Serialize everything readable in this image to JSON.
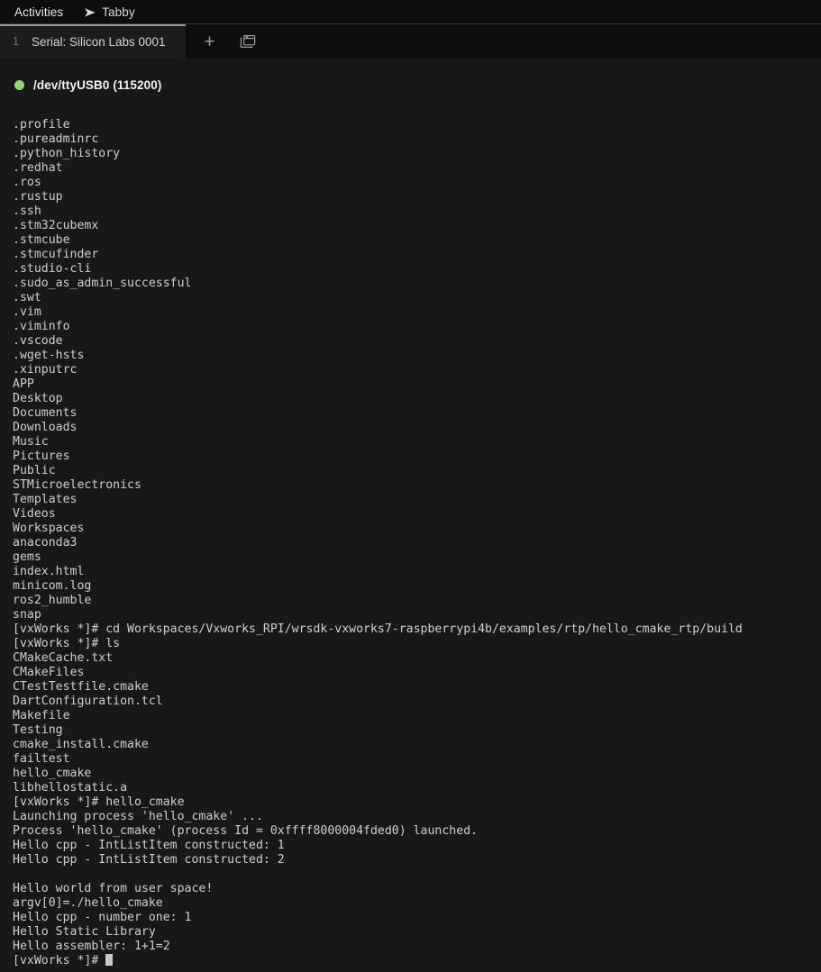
{
  "colors": {
    "topbar_bg": "#0d0d0d",
    "tabbar_bg": "#0e0e0e",
    "active_tab_bg": "#1c1c1c",
    "terminal_bg": "#181818",
    "terminal_fg": "#cfcfcf",
    "status_green": "#8fd96a",
    "cursor": "#c8c8c8",
    "app_title": "#cfd9e6"
  },
  "topbar": {
    "activities_label": "Activities",
    "app_glyph": "➤",
    "app_title": "Tabby"
  },
  "tabbar": {
    "tabs": [
      {
        "index": "1",
        "label": "Serial: Silicon Labs 0001",
        "active": true
      }
    ],
    "new_tab_label": "+",
    "new_tab_icon": "plus-icon",
    "profiles_icon": "stacked-windows-icon"
  },
  "terminal": {
    "connection": {
      "status_icon": "green-dot-icon",
      "label": "/dev/ttyUSB0 (115200)"
    },
    "cursor": "█",
    "lines": [
      ".profile",
      ".pureadminrc",
      ".python_history",
      ".redhat",
      ".ros",
      ".rustup",
      ".ssh",
      ".stm32cubemx",
      ".stmcube",
      ".stmcufinder",
      ".studio-cli",
      ".sudo_as_admin_successful",
      ".swt",
      ".vim",
      ".viminfo",
      ".vscode",
      ".wget-hsts",
      ".xinputrc",
      "APP",
      "Desktop",
      "Documents",
      "Downloads",
      "Music",
      "Pictures",
      "Public",
      "STMicroelectronics",
      "Templates",
      "Videos",
      "Workspaces",
      "anaconda3",
      "gems",
      "index.html",
      "minicom.log",
      "ros2_humble",
      "snap",
      "[vxWorks *]# cd Workspaces/Vxworks_RPI/wrsdk-vxworks7-raspberrypi4b/examples/rtp/hello_cmake_rtp/build",
      "[vxWorks *]# ls",
      "CMakeCache.txt",
      "CMakeFiles",
      "CTestTestfile.cmake",
      "DartConfiguration.tcl",
      "Makefile",
      "Testing",
      "cmake_install.cmake",
      "failtest",
      "hello_cmake",
      "libhellostatic.a",
      "[vxWorks *]# hello_cmake",
      "Launching process 'hello_cmake' ...",
      "Process 'hello_cmake' (process Id = 0xffff8000004fded0) launched.",
      "Hello cpp - IntListItem constructed: 1",
      "Hello cpp - IntListItem constructed: 2",
      "",
      "Hello world from user space!",
      "argv[0]=./hello_cmake",
      "Hello cpp - number one: 1",
      "Hello Static Library",
      "Hello assembler: 1+1=2"
    ],
    "prompt": "[vxWorks *]# "
  }
}
